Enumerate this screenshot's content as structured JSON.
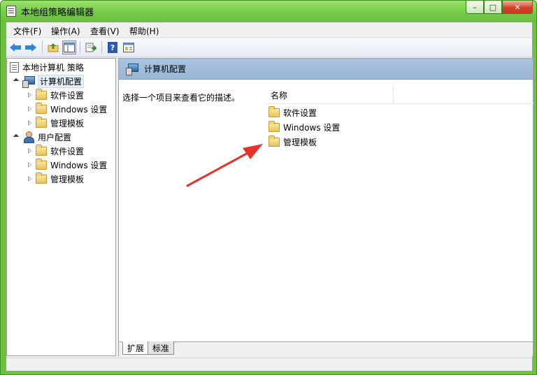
{
  "window": {
    "title": "本地组策略编辑器",
    "controls": {
      "minimize": "–",
      "maximize": "□",
      "close": "✕"
    }
  },
  "menu": [
    "文件(F)",
    "操作(A)",
    "查看(V)",
    "帮助(H)"
  ],
  "toolbar": {
    "icons": [
      "back-arrow-icon",
      "forward-arrow-icon",
      "up-folder-icon",
      "show-hide-tree-icon",
      "export-list-icon",
      "help-icon",
      "properties-icon"
    ],
    "help_glyph": "?"
  },
  "tree": {
    "root": "本地计算机 策略",
    "computer": {
      "label": "计算机配置",
      "children": [
        "软件设置",
        "Windows 设置",
        "管理模板"
      ]
    },
    "user": {
      "label": "用户配置",
      "children": [
        "软件设置",
        "Windows 设置",
        "管理模板"
      ]
    }
  },
  "right": {
    "header_title": "计算机配置",
    "description": "选择一个项目来查看它的描述。",
    "column_name": "名称",
    "items": [
      "软件设置",
      "Windows 设置",
      "管理模板"
    ]
  },
  "tabs": [
    "扩展",
    "标准"
  ],
  "colors": {
    "titlebar": "#73c947",
    "header_band": "#a9c4df",
    "annotation_arrow": "#e5322d"
  }
}
